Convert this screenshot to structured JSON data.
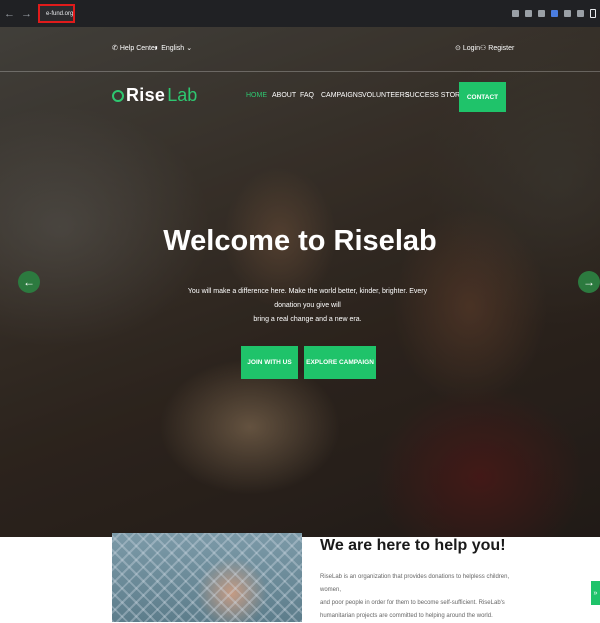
{
  "browser": {
    "url": "e-fund.org",
    "back_icon": "arrow-left",
    "forward_icon": "arrow-right",
    "reload_icon": "reload"
  },
  "topbar": {
    "help_label": "Help Center",
    "language_label": "English",
    "login_label": "Login",
    "register_label": "Register"
  },
  "brand": {
    "rise": "Rise",
    "lab": "Lab",
    "accent": "#2ec770"
  },
  "nav": {
    "items": [
      {
        "label": "HOME"
      },
      {
        "label": "ABOUT"
      },
      {
        "label": "FAQ"
      },
      {
        "label": "CAMPAIGNS"
      },
      {
        "label": "VOLUNTEERS"
      },
      {
        "label": "SUCCESS STORY"
      }
    ],
    "contact_label": "CONTACT"
  },
  "hero": {
    "title": "Welcome to Riselab",
    "subtitle_line1": "You will make a difference here. Make the world better, kinder, brighter. Every donation you give will",
    "subtitle_line2": "bring a real change and a new era.",
    "join_label": "JOIN WITH US",
    "explore_label": "EXPLORE CAMPAIGN",
    "prev_icon": "←",
    "next_icon": "→"
  },
  "about": {
    "title": "We are here to help you!",
    "line1": "RiseLab is an organization that provides donations to helpless children, women,",
    "line2": "and poor people in order for them to become self-sufficient. RiseLab's",
    "line3": "humanitarian projects are committed to helping around the world."
  }
}
